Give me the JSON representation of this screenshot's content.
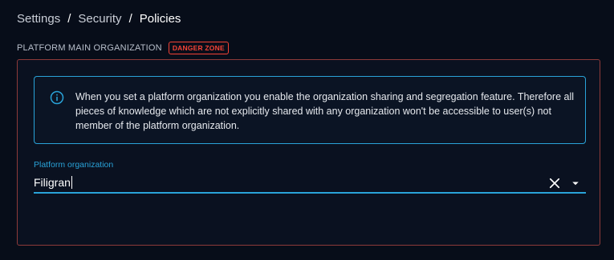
{
  "breadcrumb": {
    "items": [
      "Settings",
      "Security",
      "Policies"
    ],
    "separator": "/"
  },
  "section": {
    "title": "PLATFORM MAIN ORGANIZATION",
    "badge": "DANGER ZONE"
  },
  "alert": {
    "icon": "info-icon",
    "text": "When you set a platform organization you enable the organization sharing and segregation feature. Therefore all pieces of knowledge which are not explicitly shared with any organization won't be accessible to user(s) not member of the platform organization."
  },
  "platform_field": {
    "label": "Platform organization",
    "value": "Filigran",
    "clear_icon": "close-icon",
    "dropdown_icon": "arrow-drop-down-icon"
  },
  "colors": {
    "background": "#070d19",
    "accent": "#29a3d9",
    "danger": "#f44336",
    "danger_border": "#8e3a3a"
  }
}
